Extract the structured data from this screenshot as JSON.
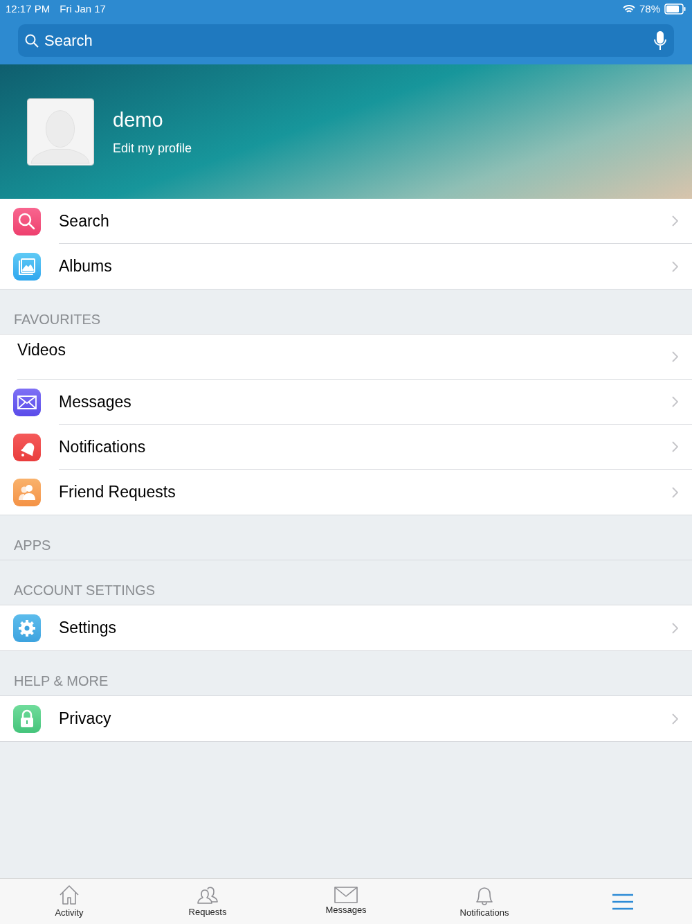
{
  "status_bar": {
    "time": "12:17 PM",
    "date": "Fri Jan 17",
    "battery": "78%"
  },
  "search": {
    "placeholder": "Search"
  },
  "profile": {
    "name": "demo",
    "subtitle": "Edit my profile"
  },
  "sections": [
    {
      "rows": [
        {
          "kind": "search",
          "label": "Search"
        },
        {
          "kind": "albums",
          "label": "Albums"
        }
      ]
    },
    {
      "header": "FAVOURITES",
      "rows": [
        {
          "kind": "plain",
          "label": "Videos"
        },
        {
          "kind": "messages",
          "label": "Messages"
        },
        {
          "kind": "notifications",
          "label": "Notifications"
        },
        {
          "kind": "friends",
          "label": "Friend Requests"
        }
      ]
    },
    {
      "header": "APPS"
    },
    {
      "header": "ACCOUNT SETTINGS",
      "rows": [
        {
          "kind": "settings",
          "label": "Settings"
        }
      ]
    },
    {
      "header": "HELP & MORE",
      "rows": [
        {
          "kind": "privacy",
          "label": "Privacy"
        }
      ]
    }
  ],
  "tab_bar": [
    {
      "kind": "home",
      "label": "Activity",
      "selected": false
    },
    {
      "kind": "friends",
      "label": "Requests",
      "selected": false
    },
    {
      "kind": "mail",
      "label": "Messages",
      "selected": false
    },
    {
      "kind": "bell",
      "label": "Notifications",
      "selected": false
    },
    {
      "kind": "menu",
      "selected": true
    }
  ]
}
